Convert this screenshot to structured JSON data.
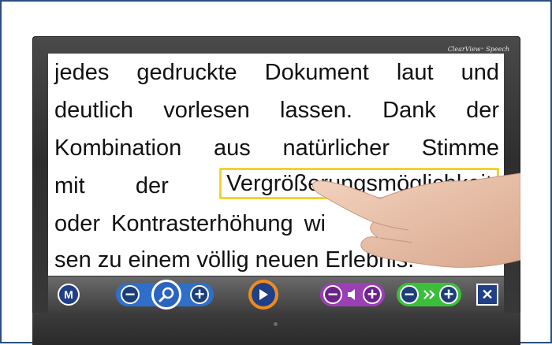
{
  "monitor": {
    "brand": "ClearView⁺ Speech"
  },
  "screen": {
    "lines": [
      [
        "jedes",
        "gedruckte",
        "Dokument",
        "laut",
        "und"
      ],
      [
        "deutlich",
        "vorlesen",
        "lassen.",
        "Dank",
        "der"
      ],
      [
        "Kombination",
        "aus",
        "natürlicher",
        "Stimme"
      ],
      [
        "mit",
        "der"
      ],
      [
        "oder",
        "Kontrasterhöhung",
        "wi"
      ],
      [
        "sen zu einem völlig neuen Erlebnis."
      ]
    ],
    "highlighted_word": "Vergrößerungsmöglichkeit"
  },
  "toolbar": {
    "menu_label": "M",
    "zoom_out_label": "−",
    "zoom_in_label": "+",
    "volume_down_label": "−",
    "volume_up_label": "+",
    "speed_down_label": "−",
    "speed_up_label": "+",
    "close_label": "✕"
  },
  "colors": {
    "frame_border": "#2b4f7e",
    "highlight": "#f1d230",
    "zoom_blue": "#2f6fc9",
    "play_orange": "#f08a1a",
    "volume_purple": "#9b3fb5",
    "speed_green": "#3bbf3b",
    "close_navy": "#1f3f86"
  }
}
